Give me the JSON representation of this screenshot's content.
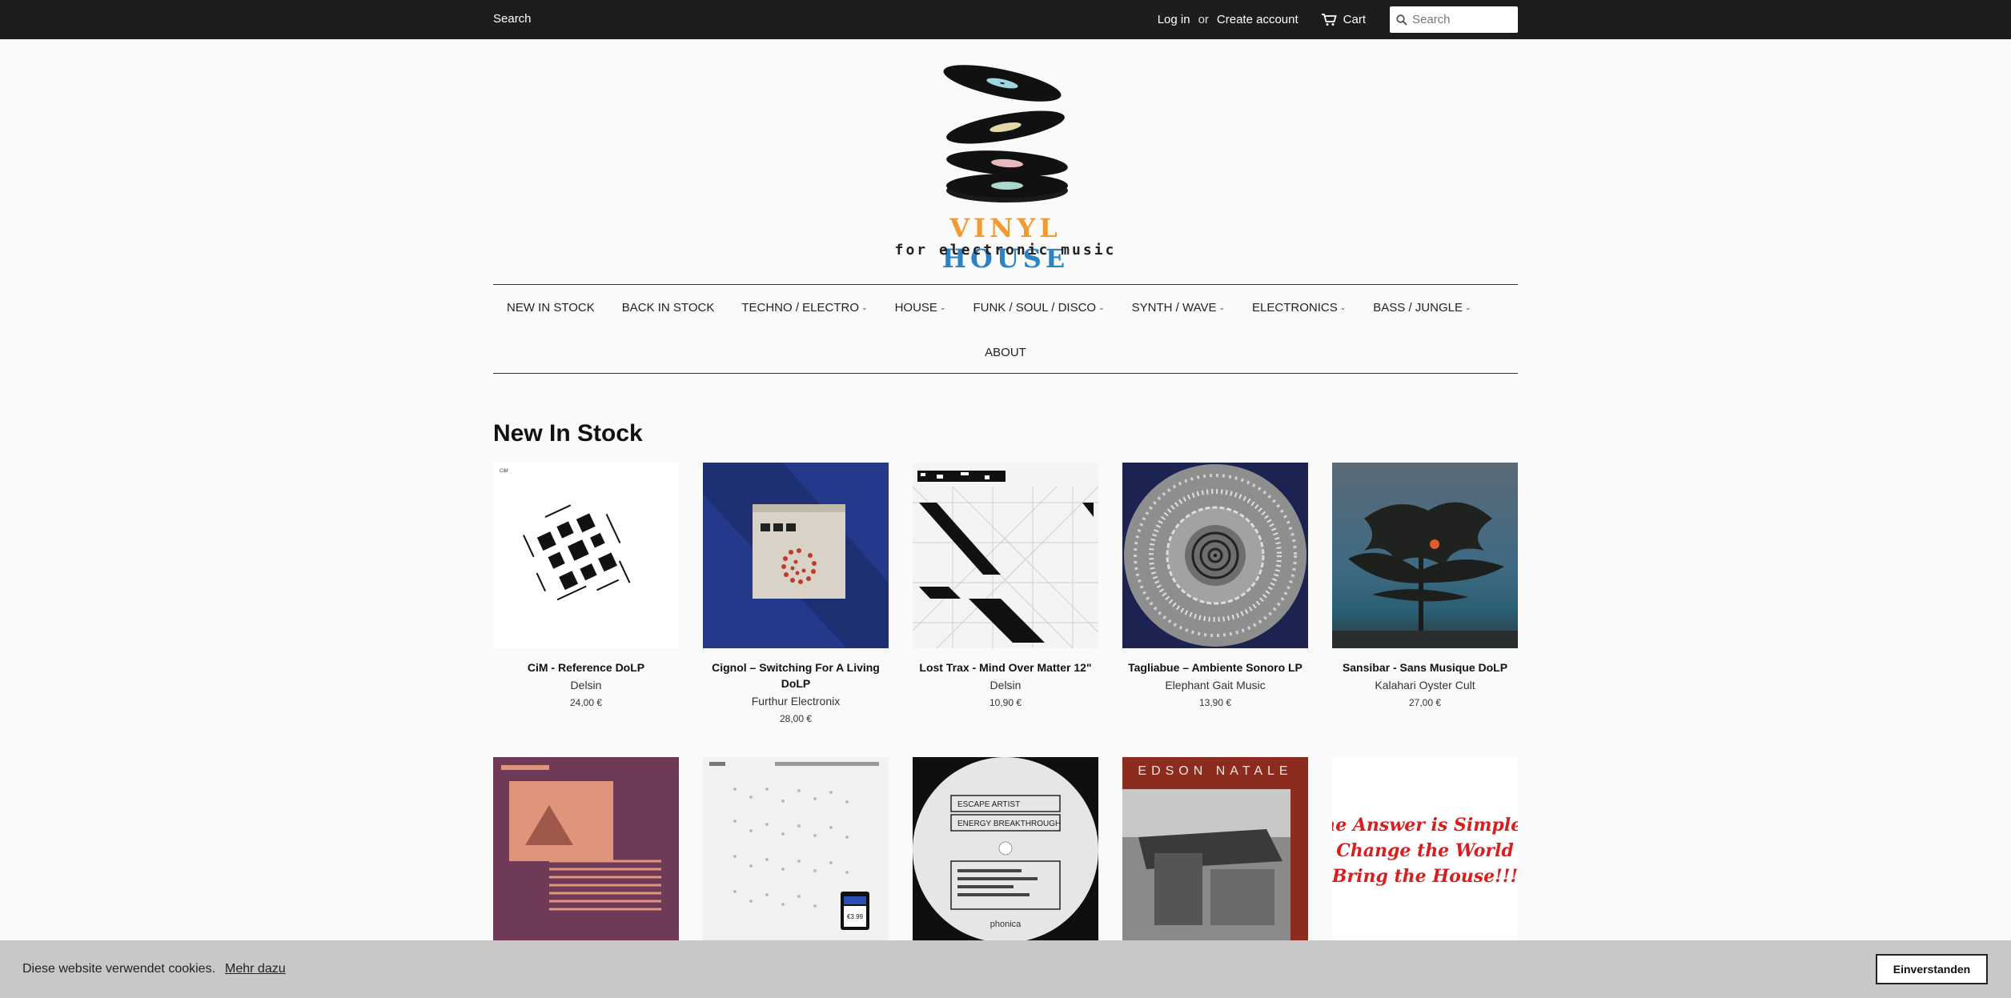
{
  "topbar": {
    "search_link": "Search",
    "login": "Log in",
    "or": "or",
    "create_account": "Create account",
    "cart": "Cart",
    "search_placeholder": "Search"
  },
  "logo": {
    "word1": "VINYL",
    "word2": "HOUSE",
    "tagline": "for electronic music",
    "colors": {
      "vinyl": "#f29a2e",
      "house": "#2b83c4"
    }
  },
  "nav": {
    "items": [
      {
        "label": "NEW IN STOCK",
        "dropdown": false
      },
      {
        "label": "BACK IN STOCK",
        "dropdown": false
      },
      {
        "label": "TECHNO / ELECTRO",
        "dropdown": true
      },
      {
        "label": "HOUSE",
        "dropdown": true
      },
      {
        "label": "FUNK / SOUL / DISCO",
        "dropdown": true
      },
      {
        "label": "SYNTH / WAVE",
        "dropdown": true
      },
      {
        "label": "ELECTRONICS",
        "dropdown": true
      },
      {
        "label": "BASS / JUNGLE",
        "dropdown": true
      }
    ],
    "about": "ABOUT",
    "chevron": "⌄"
  },
  "section_title": "New In Stock",
  "products": [
    {
      "title": "CiM - Reference DoLP",
      "vendor": "Delsin",
      "price": "24,00 €"
    },
    {
      "title": "Cignol – Switching For A Living DoLP",
      "vendor": "Furthur Electronix",
      "price": "28,00 €"
    },
    {
      "title": "Lost Trax - Mind Over Matter 12\"",
      "vendor": "Delsin",
      "price": "10,90 €"
    },
    {
      "title": "Tagliabue – Ambiente Sonoro LP",
      "vendor": "Elephant Gait Music",
      "price": "13,90 €"
    },
    {
      "title": "Sansibar - Sans Musique DoLP",
      "vendor": "Kalahari Oyster Cult",
      "price": "27,00 €"
    }
  ],
  "row2_covers": {
    "escape_artist_lines": [
      "ESCAPE ARTIST",
      "ENERGY BREAKTHROUGH"
    ],
    "escape_label": "phonica",
    "edson": "EDSON NATALE",
    "answer_lines": [
      "The Answer is Simple...",
      "Change the World",
      "Bring the House!!!"
    ],
    "sticker_price": "€3.99"
  },
  "cookie": {
    "message": "Diese website verwendet cookies.",
    "more": "Mehr dazu",
    "accept": "Einverstanden"
  }
}
